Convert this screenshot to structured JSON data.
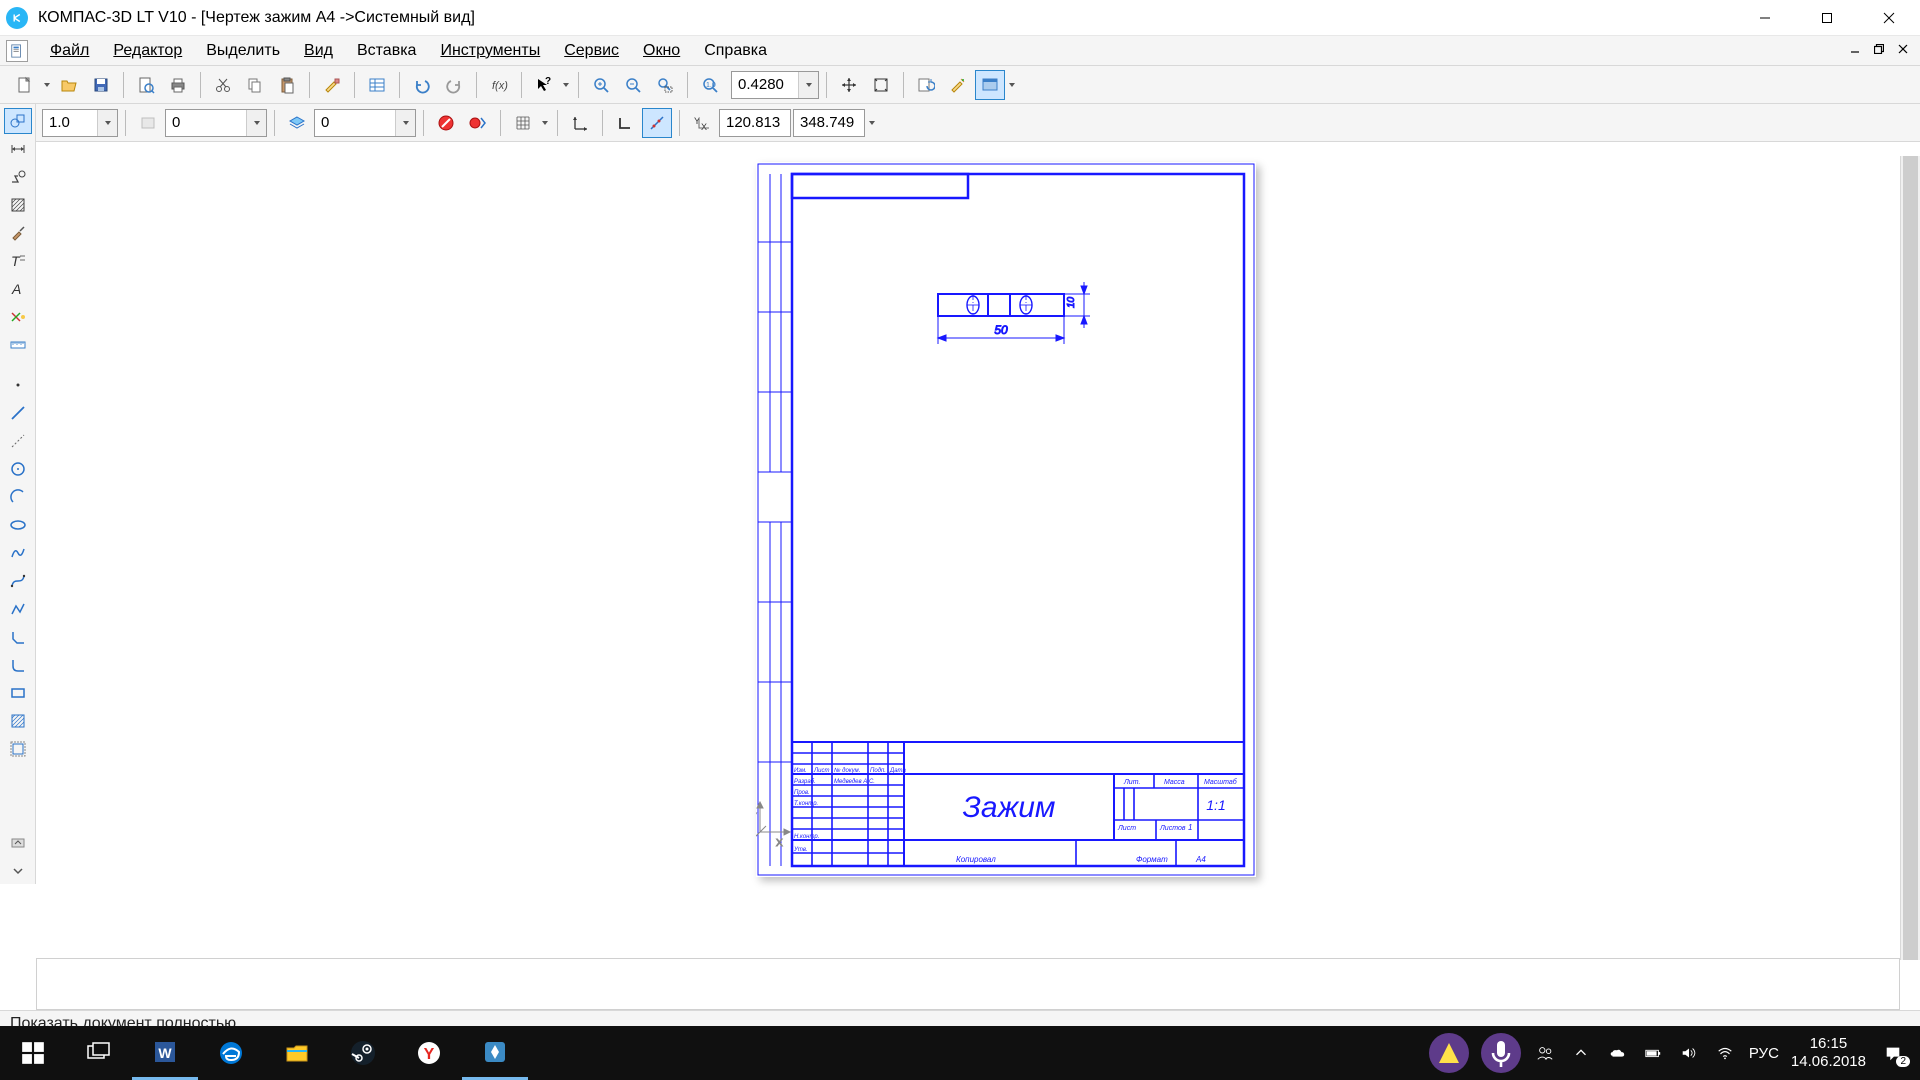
{
  "title": "КОМПАС-3D LT V10 - [Чертеж зажим А4 ->Системный вид]",
  "menu": {
    "file": "Файл",
    "editor": "Редактор",
    "select": "Выделить",
    "view": "Вид",
    "insert": "Вставка",
    "tools": "Инструменты",
    "service": "Сервис",
    "window": "Окно",
    "help": "Справка"
  },
  "toolbar1": {
    "zoom_level": "0.4280"
  },
  "toolbar2": {
    "step": "1.0",
    "style1": "0",
    "style2": "0",
    "coord_x": "120.813",
    "coord_y": "348.749"
  },
  "drawing": {
    "part_name": "Зажим",
    "dim_w": "50",
    "dim_h": "10",
    "scale_val": "1:1",
    "title_block": {
      "col_lit": "Лит.",
      "col_mass": "Масса",
      "col_scale": "Масштаб",
      "row_izm": "Изм.",
      "row_list": "Лист",
      "row_ndok": "№ докум.",
      "row_podp": "Подп.",
      "row_data": "Дата",
      "razrab": "Разраб.",
      "prov": "Пров.",
      "tkontr": "Т.контр.",
      "nkontr": "Н.контр.",
      "utv": "Утв.",
      "list": "Лист",
      "listov": "Листов",
      "listov_n": "1",
      "kopiroval": "Копировал",
      "format": "Формат",
      "format_v": "А4",
      "name": "Медведев А.С."
    }
  },
  "status": "Показать документ полностью",
  "taskbar": {
    "lang": "РУС",
    "time": "16:15",
    "date": "14.06.2018",
    "notif": "2"
  }
}
